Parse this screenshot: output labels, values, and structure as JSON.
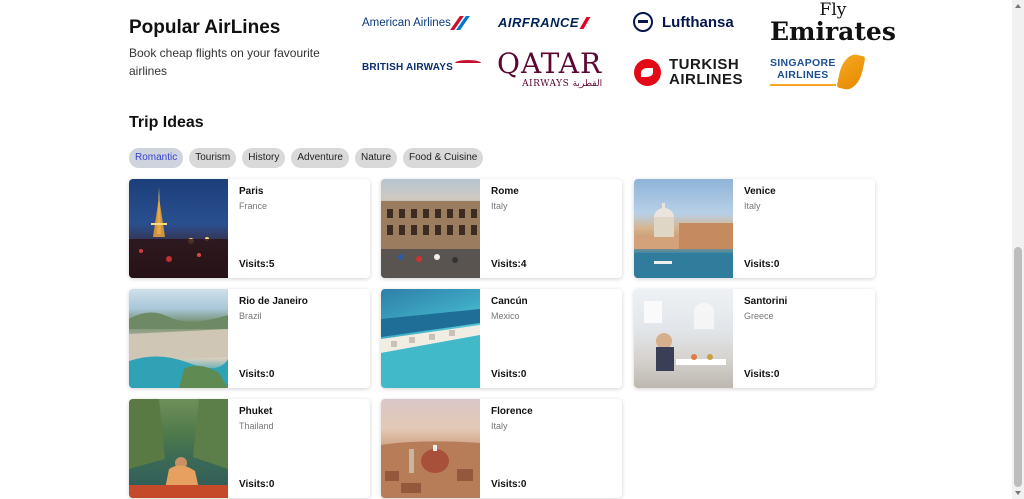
{
  "airlines": {
    "title": "Popular AirLines",
    "subtitle": "Book cheap flights on your favourite airlines",
    "logos": {
      "american": "American Airlines",
      "airfrance": "AIRFRANCE",
      "lufthansa": "Lufthansa",
      "emirates_l1": "Fly",
      "emirates_l2": "Emirates",
      "british": "BRITISH AIRWAYS",
      "qatar_l1": "QATAR",
      "qatar_l2": "AIRWAYS القطرية",
      "turkish_l1": "TURKISH",
      "turkish_l2": "AIRLINES",
      "singapore_l1": "SINGAPORE",
      "singapore_l2": "AIRLINES"
    }
  },
  "trip_ideas": {
    "title": "Trip Ideas",
    "categories": [
      "Romantic",
      "Tourism",
      "History",
      "Adventure",
      "Nature",
      "Food & Cuisine"
    ],
    "active_category": "Romantic",
    "destinations": [
      {
        "name": "Paris",
        "country": "France",
        "visits": "Visits:5"
      },
      {
        "name": "Rome",
        "country": "Italy",
        "visits": "Visits:4"
      },
      {
        "name": "Venice",
        "country": "Italy",
        "visits": "Visits:0"
      },
      {
        "name": "Rio de Janeiro",
        "country": "Brazil",
        "visits": "Visits:0"
      },
      {
        "name": "Cancún",
        "country": "Mexico",
        "visits": "Visits:0"
      },
      {
        "name": "Santorini",
        "country": "Greece",
        "visits": "Visits:0"
      },
      {
        "name": "Phuket",
        "country": "Thailand",
        "visits": "Visits:0"
      },
      {
        "name": "Florence",
        "country": "Italy",
        "visits": "Visits:0"
      }
    ]
  },
  "colors": {
    "active_chip_text": "#3344cc",
    "chip_bg": "#d9d9d9"
  }
}
